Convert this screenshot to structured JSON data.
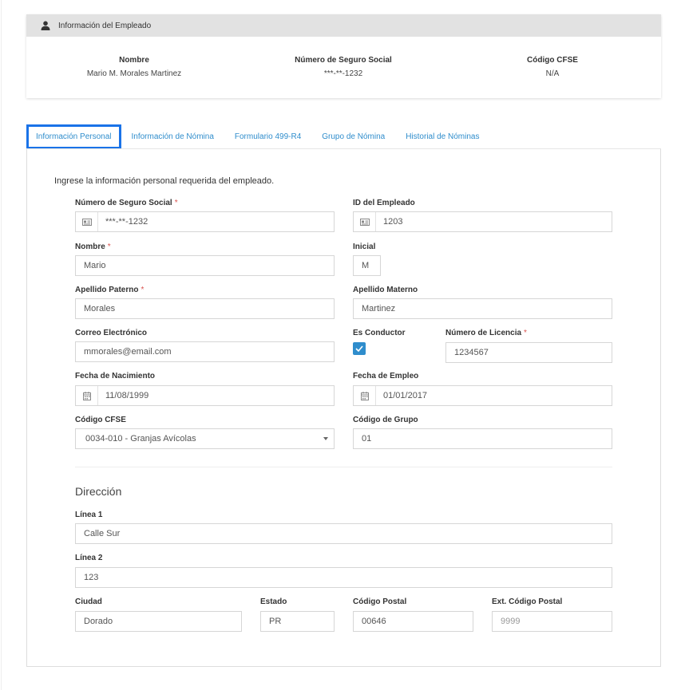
{
  "employee_card": {
    "header": "Información del Empleado",
    "columns": [
      {
        "label": "Nombre",
        "value": "Mario M. Morales Martinez"
      },
      {
        "label": "Número de Seguro Social",
        "value": "***-**-1232"
      },
      {
        "label": "Código CFSE",
        "value": "N/A"
      }
    ]
  },
  "tabs": [
    {
      "label": "Información Personal",
      "active": true
    },
    {
      "label": "Información de Nómina",
      "active": false
    },
    {
      "label": "Formulario 499-R4",
      "active": false
    },
    {
      "label": "Grupo de Nómina",
      "active": false
    },
    {
      "label": "Historial de Nóminas",
      "active": false
    }
  ],
  "form": {
    "intro": "Ingrese la información personal requerida del empleado.",
    "ssn": {
      "label": "Número de Seguro Social",
      "value": "***-**-1232"
    },
    "employee_id": {
      "label": "ID del Empleado",
      "value": "1203"
    },
    "first_name": {
      "label": "Nombre",
      "value": "Mario"
    },
    "initial": {
      "label": "Inicial",
      "value": "M"
    },
    "last_name_paternal": {
      "label": "Apellido Paterno",
      "value": "Morales"
    },
    "last_name_maternal": {
      "label": "Apellido Materno",
      "value": "Martinez"
    },
    "email": {
      "label": "Correo Electrónico",
      "value": "mmorales@email.com"
    },
    "is_driver": {
      "label": "Es Conductor",
      "checked": true
    },
    "license_number": {
      "label": "Número de Licencia",
      "value": "1234567"
    },
    "birth_date": {
      "label": "Fecha de Nacimiento",
      "value": "11/08/1999"
    },
    "hire_date": {
      "label": "Fecha de Empleo",
      "value": "01/01/2017"
    },
    "cfse_code": {
      "label": "Código CFSE",
      "value": "0034-010 - Granjas Avícolas"
    },
    "group_code": {
      "label": "Código de Grupo",
      "value": "01"
    },
    "required_mark": "*"
  },
  "address": {
    "title": "Dirección",
    "line1": {
      "label": "Línea 1",
      "value": "Calle Sur"
    },
    "line2": {
      "label": "Línea 2",
      "value": "123"
    },
    "city": {
      "label": "Ciudad",
      "value": "Dorado"
    },
    "state": {
      "label": "Estado",
      "value": "PR"
    },
    "zip": {
      "label": "Código Postal",
      "value": "00646"
    },
    "zip_ext": {
      "label": "Ext. Código Postal",
      "placeholder": "9999"
    }
  },
  "colors": {
    "accent": "#2f8dcc",
    "active_tab_border": "#1a73e8",
    "required": "#d9534f",
    "header_bg": "#e2e2e2"
  },
  "icons": {
    "header": "user-icon",
    "ssn": "id-card-icon",
    "employee_id": "id-card-icon",
    "birth_date": "calendar-icon",
    "hire_date": "calendar-icon",
    "cfse_select": "caret-down-icon",
    "checkbox": "check-icon"
  }
}
